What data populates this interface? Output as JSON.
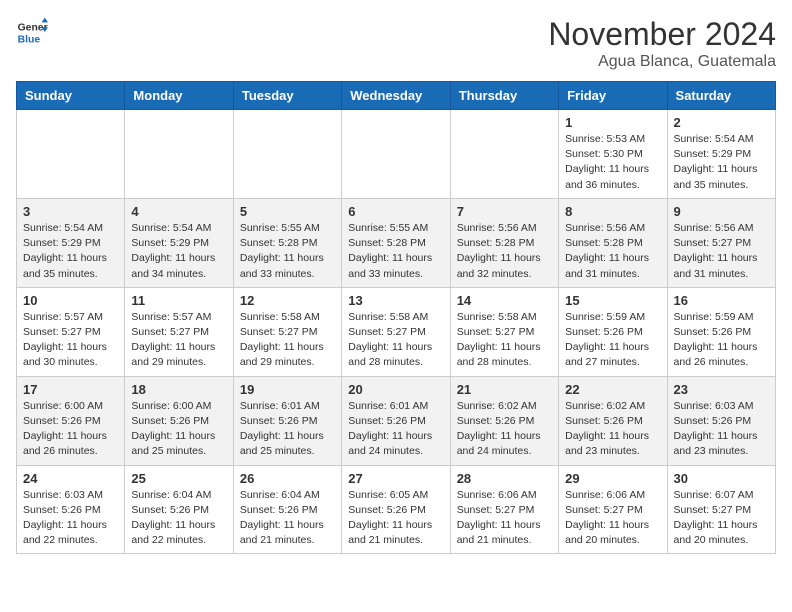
{
  "header": {
    "logo_line1": "General",
    "logo_line2": "Blue",
    "month": "November 2024",
    "location": "Agua Blanca, Guatemala"
  },
  "weekdays": [
    "Sunday",
    "Monday",
    "Tuesday",
    "Wednesday",
    "Thursday",
    "Friday",
    "Saturday"
  ],
  "weeks": [
    [
      {
        "day": "",
        "info": ""
      },
      {
        "day": "",
        "info": ""
      },
      {
        "day": "",
        "info": ""
      },
      {
        "day": "",
        "info": ""
      },
      {
        "day": "",
        "info": ""
      },
      {
        "day": "1",
        "info": "Sunrise: 5:53 AM\nSunset: 5:30 PM\nDaylight: 11 hours\nand 36 minutes."
      },
      {
        "day": "2",
        "info": "Sunrise: 5:54 AM\nSunset: 5:29 PM\nDaylight: 11 hours\nand 35 minutes."
      }
    ],
    [
      {
        "day": "3",
        "info": "Sunrise: 5:54 AM\nSunset: 5:29 PM\nDaylight: 11 hours\nand 35 minutes."
      },
      {
        "day": "4",
        "info": "Sunrise: 5:54 AM\nSunset: 5:29 PM\nDaylight: 11 hours\nand 34 minutes."
      },
      {
        "day": "5",
        "info": "Sunrise: 5:55 AM\nSunset: 5:28 PM\nDaylight: 11 hours\nand 33 minutes."
      },
      {
        "day": "6",
        "info": "Sunrise: 5:55 AM\nSunset: 5:28 PM\nDaylight: 11 hours\nand 33 minutes."
      },
      {
        "day": "7",
        "info": "Sunrise: 5:56 AM\nSunset: 5:28 PM\nDaylight: 11 hours\nand 32 minutes."
      },
      {
        "day": "8",
        "info": "Sunrise: 5:56 AM\nSunset: 5:28 PM\nDaylight: 11 hours\nand 31 minutes."
      },
      {
        "day": "9",
        "info": "Sunrise: 5:56 AM\nSunset: 5:27 PM\nDaylight: 11 hours\nand 31 minutes."
      }
    ],
    [
      {
        "day": "10",
        "info": "Sunrise: 5:57 AM\nSunset: 5:27 PM\nDaylight: 11 hours\nand 30 minutes."
      },
      {
        "day": "11",
        "info": "Sunrise: 5:57 AM\nSunset: 5:27 PM\nDaylight: 11 hours\nand 29 minutes."
      },
      {
        "day": "12",
        "info": "Sunrise: 5:58 AM\nSunset: 5:27 PM\nDaylight: 11 hours\nand 29 minutes."
      },
      {
        "day": "13",
        "info": "Sunrise: 5:58 AM\nSunset: 5:27 PM\nDaylight: 11 hours\nand 28 minutes."
      },
      {
        "day": "14",
        "info": "Sunrise: 5:58 AM\nSunset: 5:27 PM\nDaylight: 11 hours\nand 28 minutes."
      },
      {
        "day": "15",
        "info": "Sunrise: 5:59 AM\nSunset: 5:26 PM\nDaylight: 11 hours\nand 27 minutes."
      },
      {
        "day": "16",
        "info": "Sunrise: 5:59 AM\nSunset: 5:26 PM\nDaylight: 11 hours\nand 26 minutes."
      }
    ],
    [
      {
        "day": "17",
        "info": "Sunrise: 6:00 AM\nSunset: 5:26 PM\nDaylight: 11 hours\nand 26 minutes."
      },
      {
        "day": "18",
        "info": "Sunrise: 6:00 AM\nSunset: 5:26 PM\nDaylight: 11 hours\nand 25 minutes."
      },
      {
        "day": "19",
        "info": "Sunrise: 6:01 AM\nSunset: 5:26 PM\nDaylight: 11 hours\nand 25 minutes."
      },
      {
        "day": "20",
        "info": "Sunrise: 6:01 AM\nSunset: 5:26 PM\nDaylight: 11 hours\nand 24 minutes."
      },
      {
        "day": "21",
        "info": "Sunrise: 6:02 AM\nSunset: 5:26 PM\nDaylight: 11 hours\nand 24 minutes."
      },
      {
        "day": "22",
        "info": "Sunrise: 6:02 AM\nSunset: 5:26 PM\nDaylight: 11 hours\nand 23 minutes."
      },
      {
        "day": "23",
        "info": "Sunrise: 6:03 AM\nSunset: 5:26 PM\nDaylight: 11 hours\nand 23 minutes."
      }
    ],
    [
      {
        "day": "24",
        "info": "Sunrise: 6:03 AM\nSunset: 5:26 PM\nDaylight: 11 hours\nand 22 minutes."
      },
      {
        "day": "25",
        "info": "Sunrise: 6:04 AM\nSunset: 5:26 PM\nDaylight: 11 hours\nand 22 minutes."
      },
      {
        "day": "26",
        "info": "Sunrise: 6:04 AM\nSunset: 5:26 PM\nDaylight: 11 hours\nand 21 minutes."
      },
      {
        "day": "27",
        "info": "Sunrise: 6:05 AM\nSunset: 5:26 PM\nDaylight: 11 hours\nand 21 minutes."
      },
      {
        "day": "28",
        "info": "Sunrise: 6:06 AM\nSunset: 5:27 PM\nDaylight: 11 hours\nand 21 minutes."
      },
      {
        "day": "29",
        "info": "Sunrise: 6:06 AM\nSunset: 5:27 PM\nDaylight: 11 hours\nand 20 minutes."
      },
      {
        "day": "30",
        "info": "Sunrise: 6:07 AM\nSunset: 5:27 PM\nDaylight: 11 hours\nand 20 minutes."
      }
    ]
  ]
}
